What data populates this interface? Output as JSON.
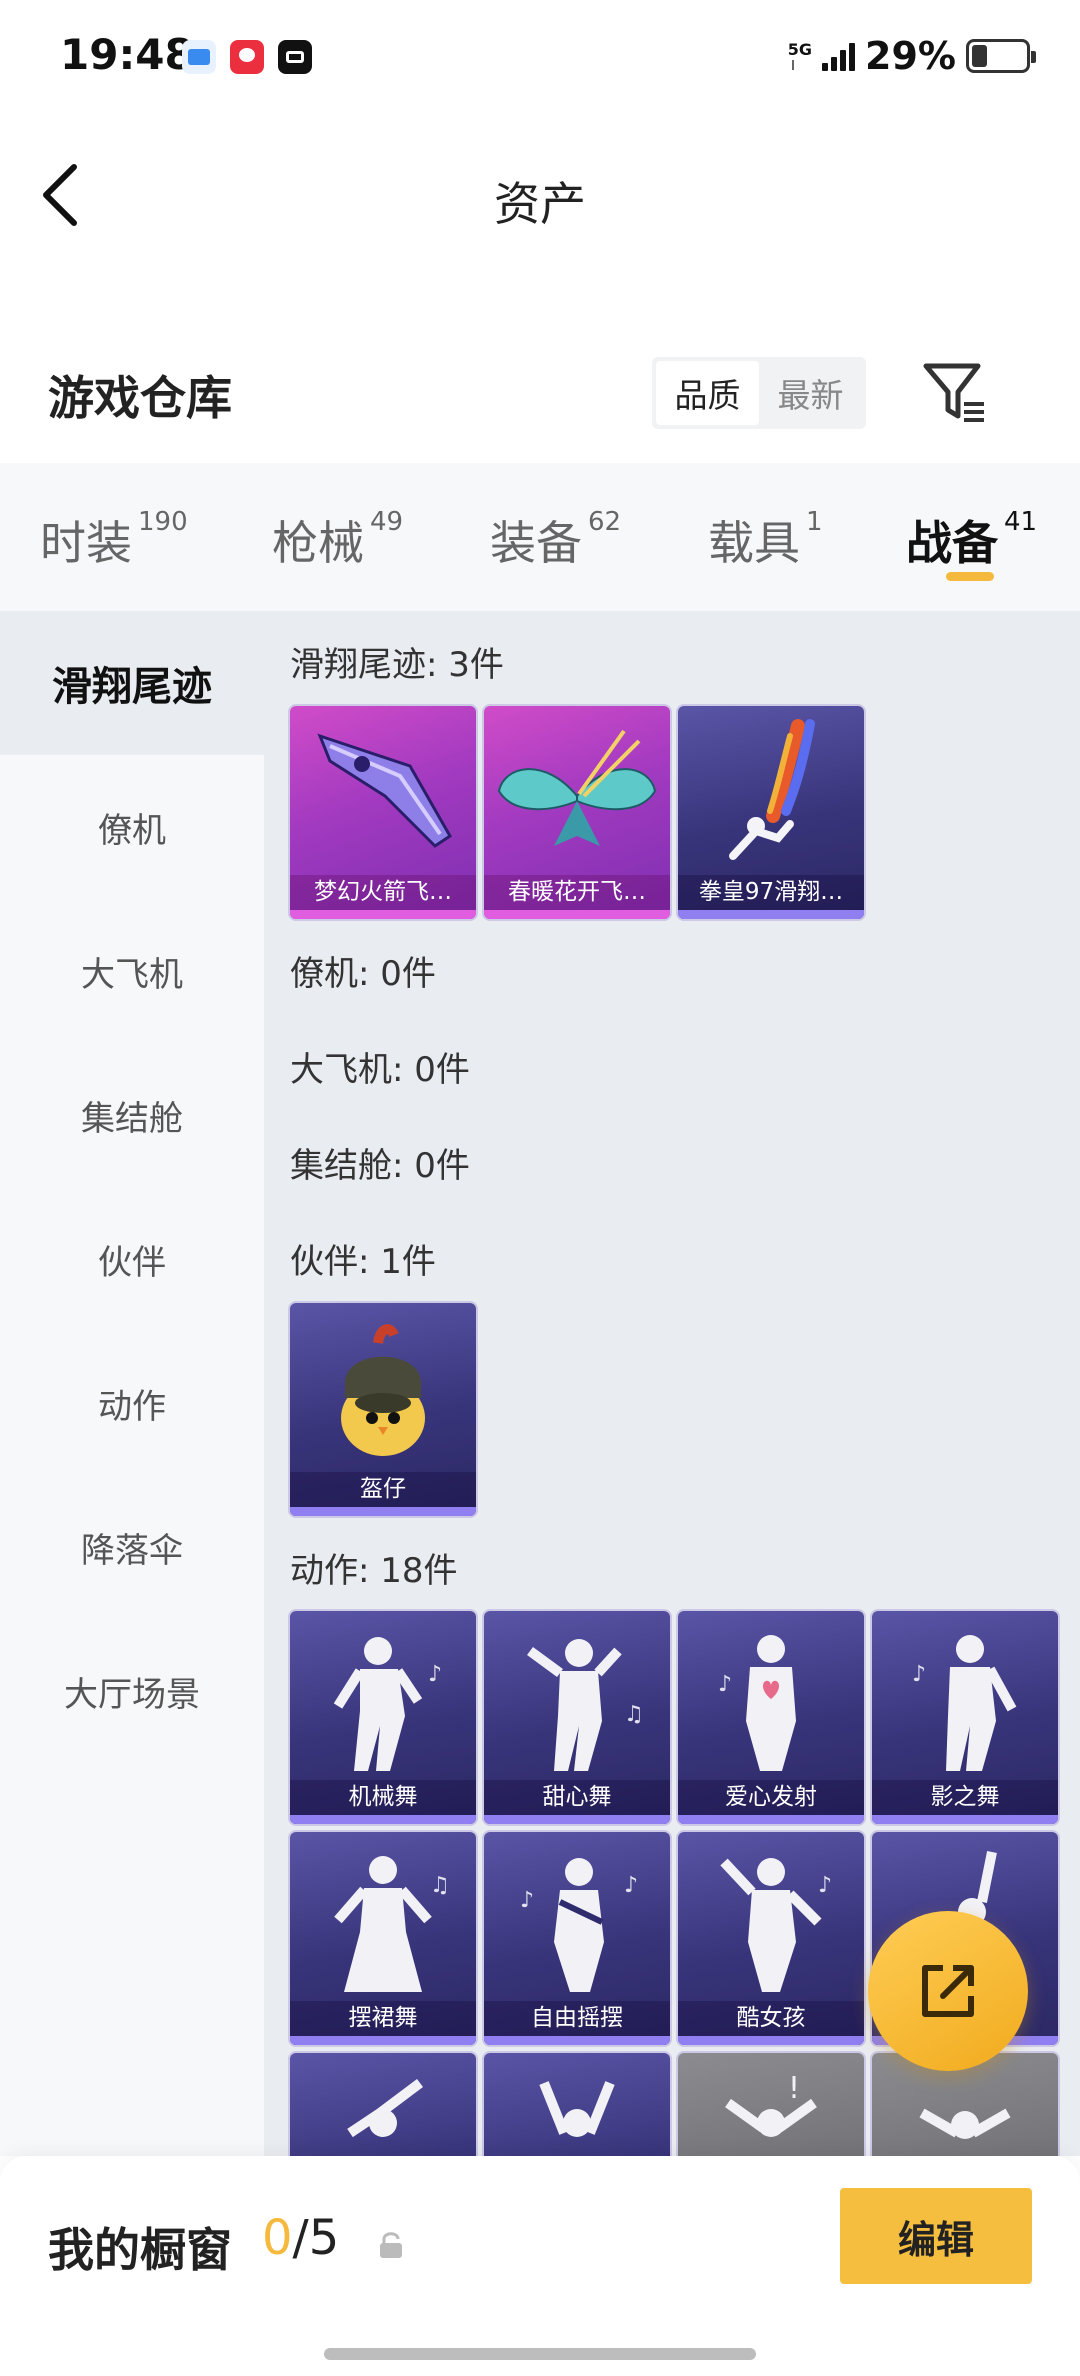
{
  "status": {
    "time": "19:48",
    "network": "5G",
    "battery": "29%",
    "battery_level": 0.29
  },
  "nav": {
    "back_icon": "chevron-left-icon",
    "title": "资产"
  },
  "warehouse": {
    "title": "游戏仓库",
    "sort_options": [
      "品质",
      "最新"
    ],
    "active_sort": "品质",
    "filter_icon": "filter-icon"
  },
  "categories": [
    {
      "name": "时装",
      "count": "190"
    },
    {
      "name": "枪械",
      "count": "49"
    },
    {
      "name": "装备",
      "count": "62"
    },
    {
      "name": "载具",
      "count": "1"
    },
    {
      "name": "战备",
      "count": "41"
    }
  ],
  "active_category": "战备",
  "sidebar": {
    "items": [
      "滑翔尾迹",
      "僚机",
      "大飞机",
      "集结舱",
      "伙伴",
      "动作",
      "降落伞",
      "大厅场景"
    ],
    "active": "滑翔尾迹"
  },
  "sections": {
    "glide": {
      "title": "滑翔尾迹: 3件",
      "items": [
        "梦幻火箭飞…",
        "春暖花开飞…",
        "拳皇97滑翔…"
      ]
    },
    "wingman": {
      "title": "僚机: 0件"
    },
    "plane": {
      "title": "大飞机: 0件"
    },
    "pod": {
      "title": "集结舱: 0件"
    },
    "partner": {
      "title": "伙伴: 1件",
      "items": [
        "盔仔"
      ]
    },
    "emote": {
      "title": "动作: 18件",
      "items": [
        "机械舞",
        "甜心舞",
        "爱心发射",
        "影之舞",
        "摆裙舞",
        "自由摇摆",
        "酷女孩"
      ]
    }
  },
  "fab": {
    "icon": "share-external-icon"
  },
  "bottom": {
    "label": "我的橱窗",
    "count_current": "0",
    "count_total": "/5",
    "lock_icon": "lock-icon",
    "edit_label": "编辑"
  },
  "colors": {
    "accent": "#f5b93e",
    "edit_button": "#f6be3f",
    "content_bg": "#e9ecf1"
  }
}
